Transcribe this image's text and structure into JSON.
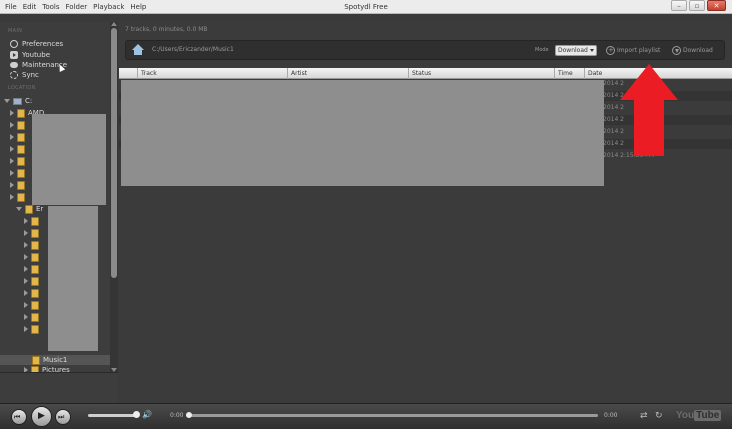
{
  "window": {
    "title": "Spotydl Free",
    "menu": [
      "File",
      "Edit",
      "Tools",
      "Folder",
      "Playback",
      "Help"
    ],
    "controls": {
      "minimize": "–",
      "maximize": "▫",
      "close": "✕"
    }
  },
  "sidebar": {
    "main_label": "MAIN",
    "items": [
      {
        "label": "Preferences",
        "icon": "gear-icon"
      },
      {
        "label": "Youtube",
        "icon": "youtube-icon"
      },
      {
        "label": "Maintenance",
        "icon": "maintenance-icon"
      },
      {
        "label": "Sync",
        "icon": "sync-icon"
      }
    ],
    "location_label": "LOCATION",
    "tree": {
      "drive": "C:",
      "partial_top": "AMD",
      "partial_sub": "Er",
      "selected": "Music1",
      "next": "Pictures"
    }
  },
  "main": {
    "stats": "7 tracks, 0 minutes, 0.0 MB",
    "path": "C:/Users/Ericzander/Music1",
    "mode_label": "Mode",
    "mode_value": "Download",
    "import_label": "Import playlist",
    "download_label": "Download",
    "columns": [
      "Track",
      "Artist",
      "Status",
      "Time",
      "Date"
    ],
    "dates": [
      "2014 2",
      "2014 2",
      "2014 2",
      "2014 2",
      "2014 2",
      "2014 2",
      "2014 2:15:36 PM"
    ]
  },
  "player": {
    "time_current": "0:00",
    "time_total": "0:00",
    "logo_you": "You",
    "logo_tube": "Tube",
    "volume_fraction": 0.9,
    "seek_fraction": 0.0
  },
  "colors": {
    "arrow": "#ec1c24",
    "background": "#3a3a3a"
  }
}
